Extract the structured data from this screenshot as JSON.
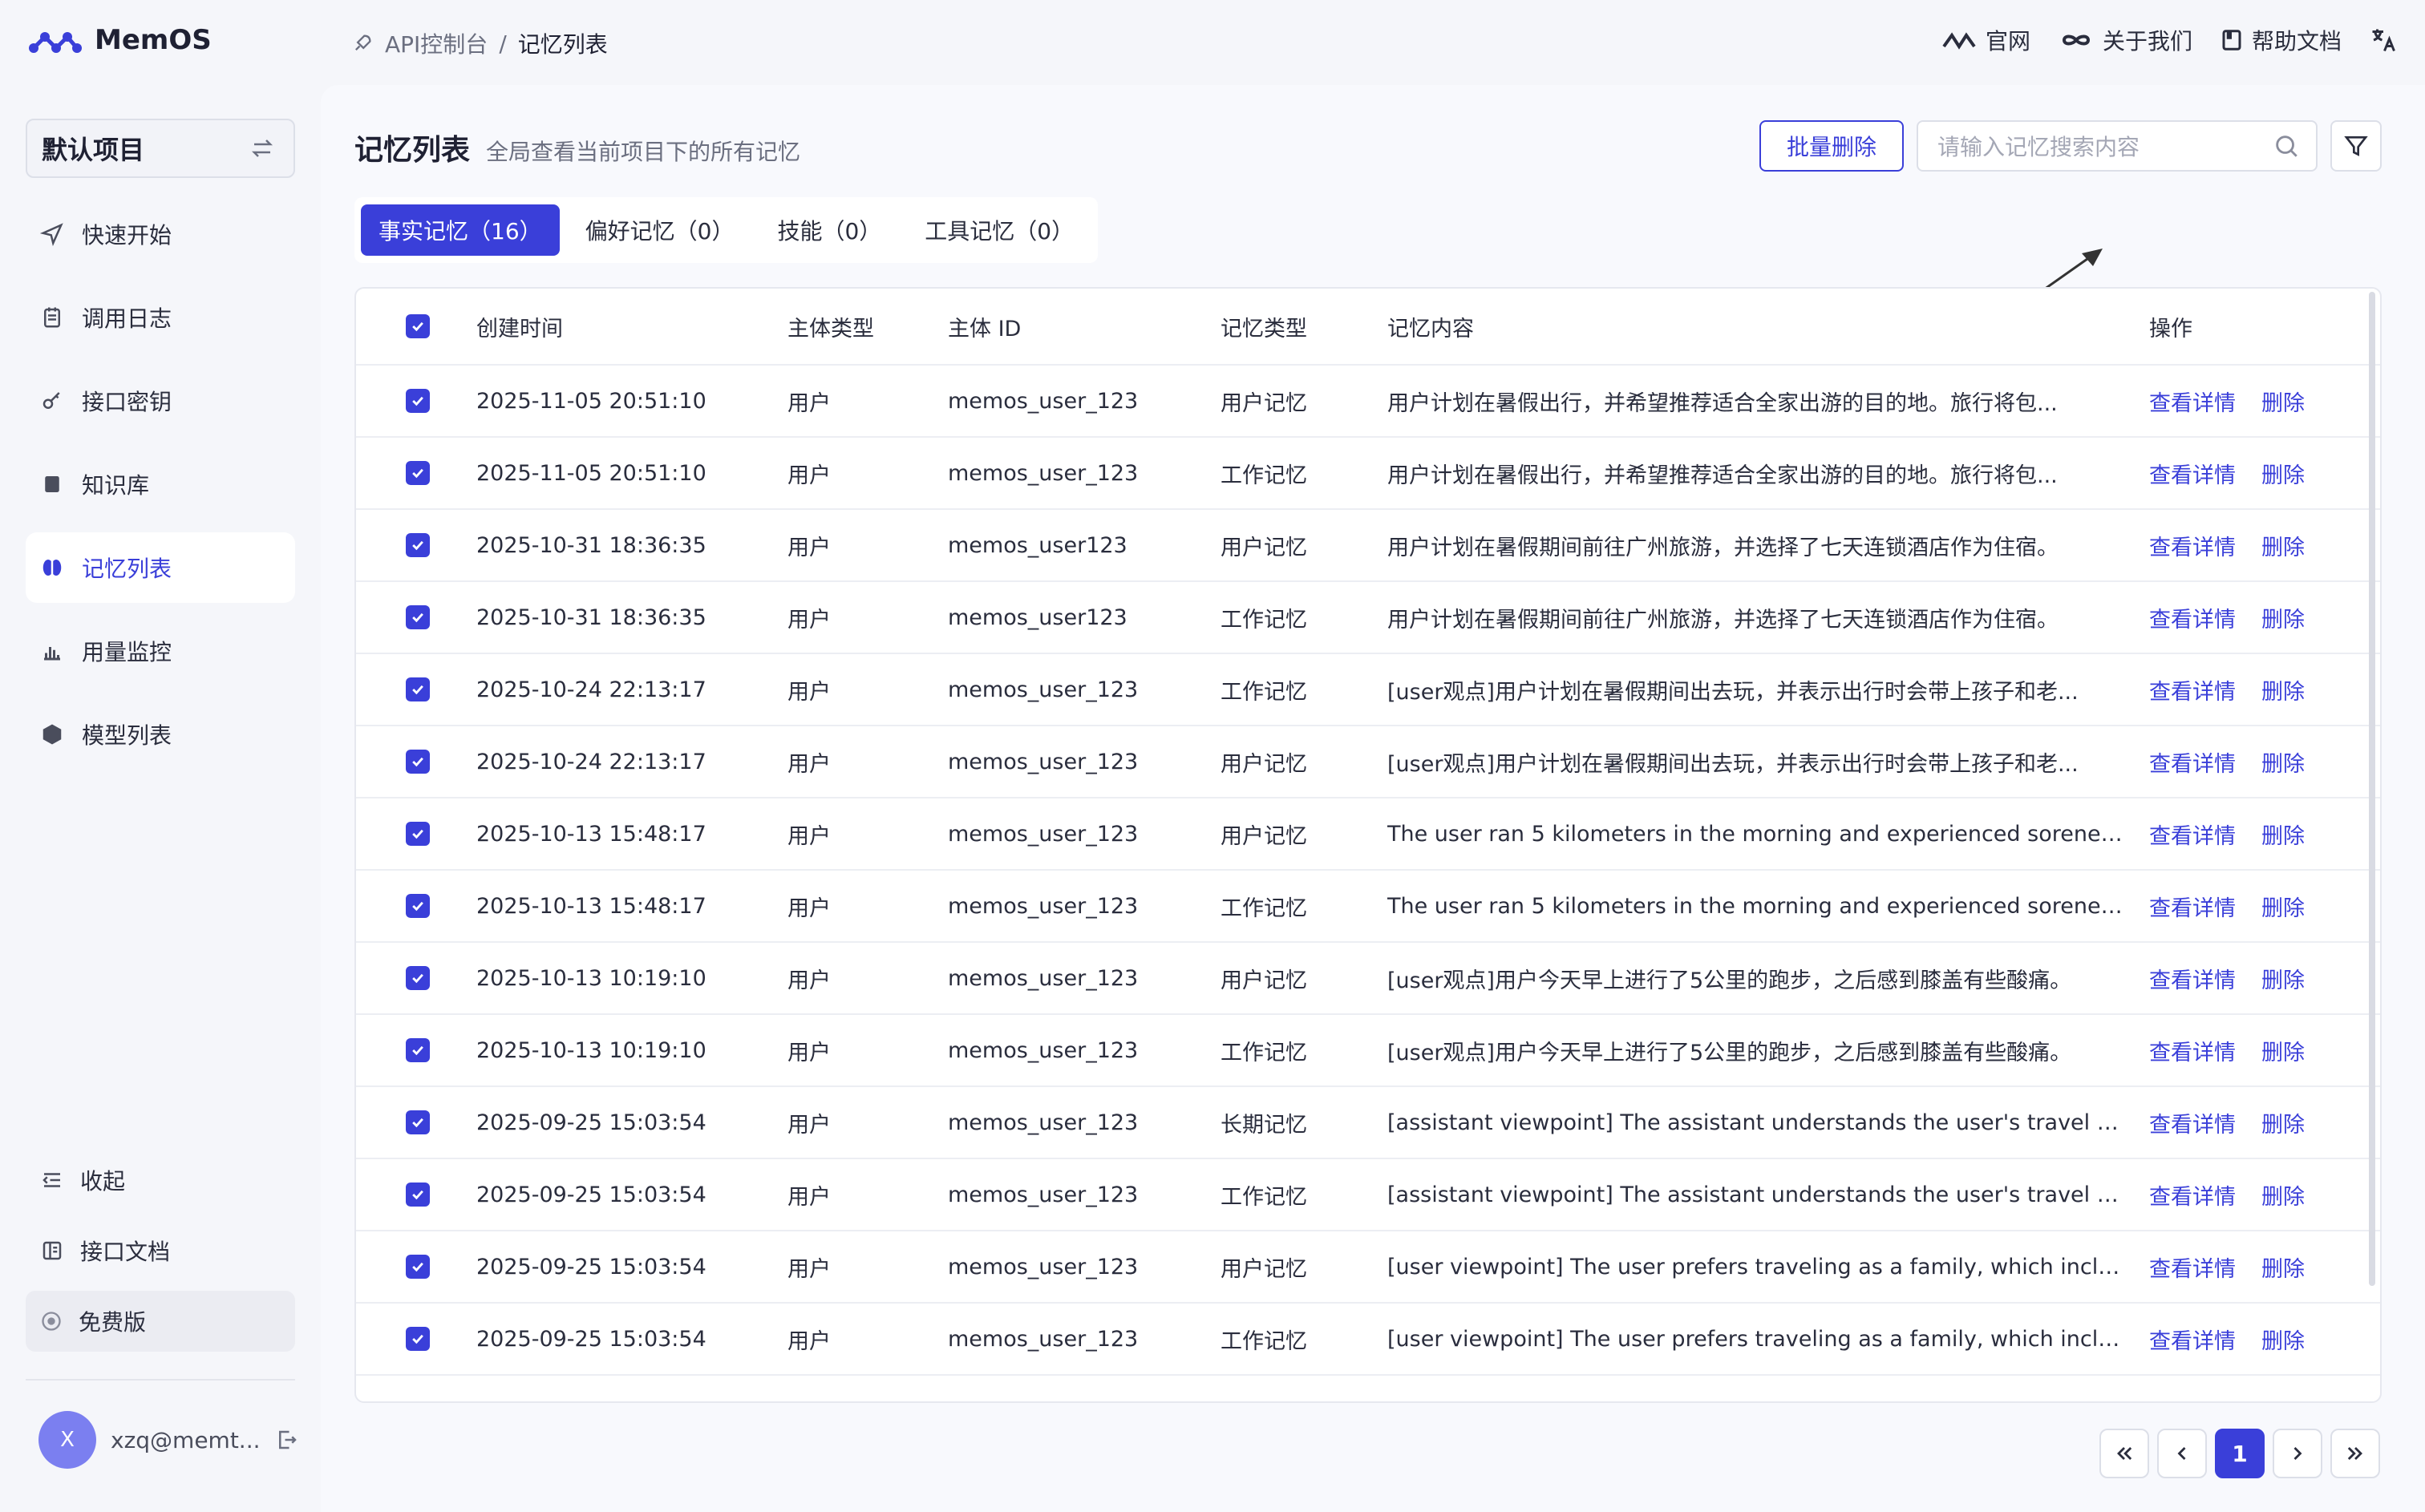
{
  "header": {
    "logo_text": "MemOS",
    "crumb_parent": "API控制台",
    "crumb_sep": "/",
    "crumb_current": "记忆列表",
    "links": [
      {
        "label": "官网",
        "icon": "memos-logo-icon"
      },
      {
        "label": "关于我们",
        "icon": "infinity-icon"
      },
      {
        "label": "帮助文档",
        "icon": "book-icon"
      }
    ],
    "translate_icon": "translate-icon"
  },
  "sidebar": {
    "project": "默认项目",
    "items": [
      {
        "label": "快速开始",
        "icon": "send-icon"
      },
      {
        "label": "调用日志",
        "icon": "log-icon"
      },
      {
        "label": "接口密钥",
        "icon": "key-icon"
      },
      {
        "label": "知识库",
        "icon": "bookmark-icon"
      },
      {
        "label": "记忆列表",
        "icon": "brain-icon"
      },
      {
        "label": "用量监控",
        "icon": "chart-icon"
      },
      {
        "label": "模型列表",
        "icon": "cube-icon"
      }
    ],
    "collapse": "收起",
    "api_docs": "接口文档",
    "plan": "免费版",
    "avatar_initial": "X",
    "user": "xzq@memt..."
  },
  "main": {
    "title": "记忆列表",
    "subtitle": "全局查看当前项目下的所有记忆",
    "batch_delete": "批量删除",
    "search_placeholder": "请输入记忆搜索内容",
    "tabs": [
      {
        "label": "事实记忆（16）"
      },
      {
        "label": "偏好记忆（0）"
      },
      {
        "label": "技能（0）"
      },
      {
        "label": "工具记忆（0）"
      }
    ],
    "columns": [
      "创建时间",
      "主体类型",
      "主体 ID",
      "记忆类型",
      "记忆内容",
      "操作"
    ],
    "view_label": "查看详情",
    "delete_label": "删除",
    "rows": [
      {
        "time": "2025-11-05 20:51:10",
        "stype": "用户",
        "sid": "memos_user_123",
        "mtype": "用户记忆",
        "content": "用户计划在暑假出行，并希望推荐适合全家出游的目的地。旅行将包..."
      },
      {
        "time": "2025-11-05 20:51:10",
        "stype": "用户",
        "sid": "memos_user_123",
        "mtype": "工作记忆",
        "content": "用户计划在暑假出行，并希望推荐适合全家出游的目的地。旅行将包..."
      },
      {
        "time": "2025-10-31 18:36:35",
        "stype": "用户",
        "sid": "memos_user123",
        "mtype": "用户记忆",
        "content": "用户计划在暑假期间前往广州旅游，并选择了七天连锁酒店作为住宿。"
      },
      {
        "time": "2025-10-31 18:36:35",
        "stype": "用户",
        "sid": "memos_user123",
        "mtype": "工作记忆",
        "content": "用户计划在暑假期间前往广州旅游，并选择了七天连锁酒店作为住宿。"
      },
      {
        "time": "2025-10-24 22:13:17",
        "stype": "用户",
        "sid": "memos_user_123",
        "mtype": "工作记忆",
        "content": "[user观点]用户计划在暑假期间出去玩，并表示出行时会带上孩子和老..."
      },
      {
        "time": "2025-10-24 22:13:17",
        "stype": "用户",
        "sid": "memos_user_123",
        "mtype": "用户记忆",
        "content": "[user观点]用户计划在暑假期间出去玩，并表示出行时会带上孩子和老..."
      },
      {
        "time": "2025-10-13 15:48:17",
        "stype": "用户",
        "sid": "memos_user_123",
        "mtype": "用户记忆",
        "content": "The user ran 5 kilometers in the morning and experienced soreness ..."
      },
      {
        "time": "2025-10-13 15:48:17",
        "stype": "用户",
        "sid": "memos_user_123",
        "mtype": "工作记忆",
        "content": "The user ran 5 kilometers in the morning and experienced soreness ..."
      },
      {
        "time": "2025-10-13 10:19:10",
        "stype": "用户",
        "sid": "memos_user_123",
        "mtype": "用户记忆",
        "content": "[user观点]用户今天早上进行了5公里的跑步，之后感到膝盖有些酸痛。"
      },
      {
        "time": "2025-10-13 10:19:10",
        "stype": "用户",
        "sid": "memos_user_123",
        "mtype": "工作记忆",
        "content": "[user观点]用户今天早上进行了5公里的跑步，之后感到膝盖有些酸痛。"
      },
      {
        "time": "2025-09-25 15:03:54",
        "stype": "用户",
        "sid": "memos_user_123",
        "mtype": "长期记忆",
        "content": "[assistant viewpoint] The assistant understands the user's travel gro..."
      },
      {
        "time": "2025-09-25 15:03:54",
        "stype": "用户",
        "sid": "memos_user_123",
        "mtype": "工作记忆",
        "content": "[assistant viewpoint] The assistant understands the user's travel gro..."
      },
      {
        "time": "2025-09-25 15:03:54",
        "stype": "用户",
        "sid": "memos_user_123",
        "mtype": "用户记忆",
        "content": "[user viewpoint] The user prefers traveling as a family, which include..."
      },
      {
        "time": "2025-09-25 15:03:54",
        "stype": "用户",
        "sid": "memos_user_123",
        "mtype": "工作记忆",
        "content": "[user viewpoint] The user prefers traveling as a family, which include..."
      }
    ],
    "pagination": {
      "current": "1"
    }
  },
  "colors": {
    "accent": "#3a3fd9",
    "bg": "#f5f6fa"
  }
}
